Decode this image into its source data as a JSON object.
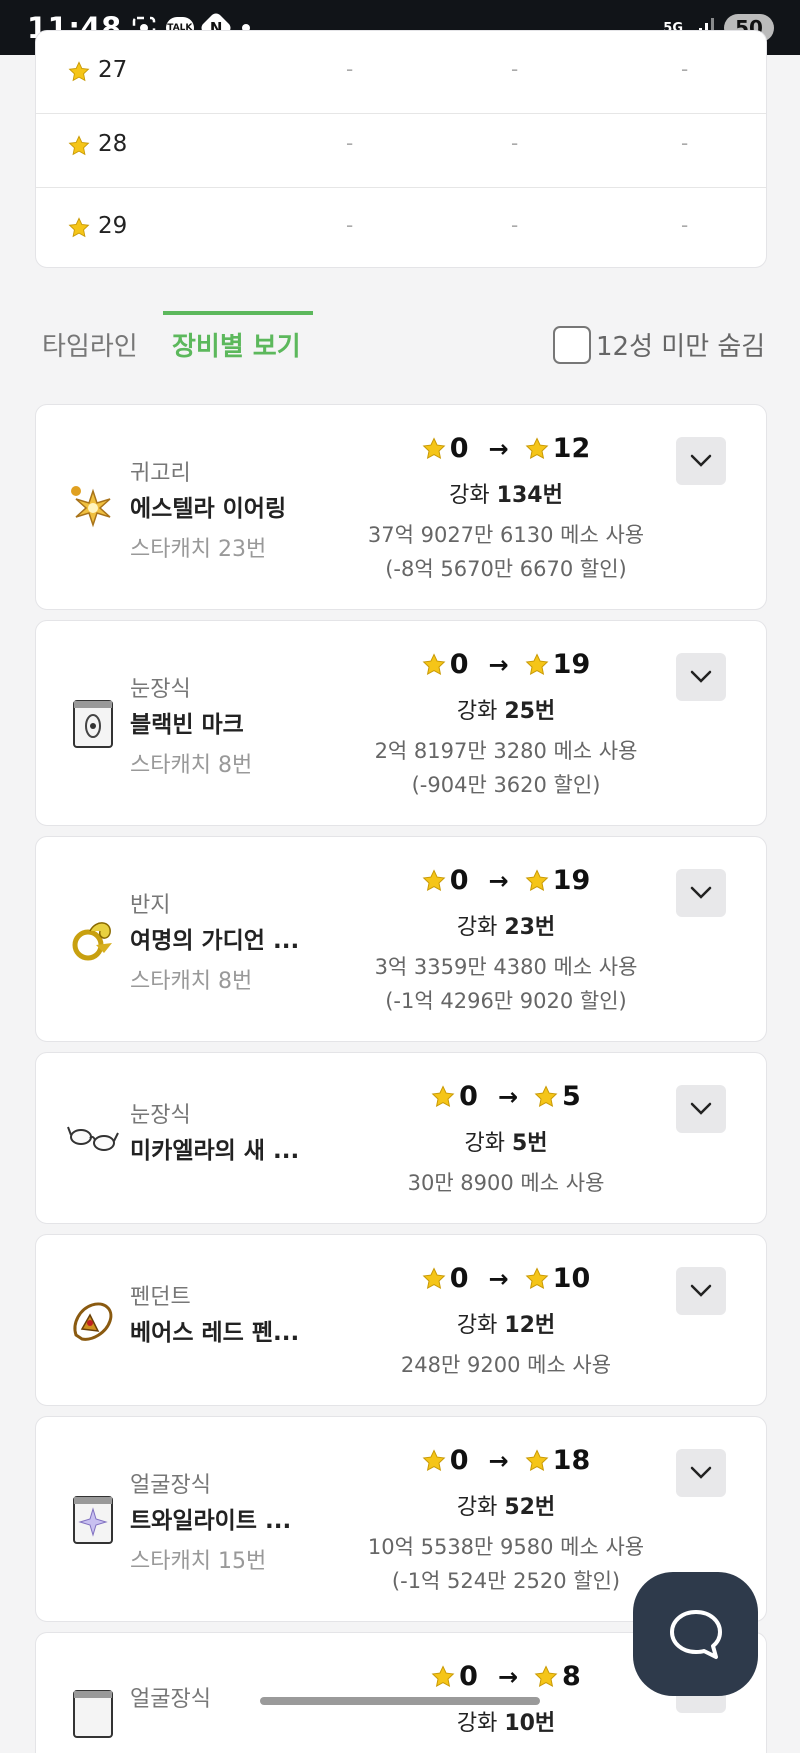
{
  "status_bar": {
    "time": "11:48",
    "talk": "TALK",
    "n": "N",
    "network": "5G",
    "battery": "50"
  },
  "table": {
    "rows": [
      {
        "star": "27",
        "c1": "-",
        "c2": "-",
        "c3": "-"
      },
      {
        "star": "28",
        "c1": "-",
        "c2": "-",
        "c3": "-"
      },
      {
        "star": "29",
        "c1": "-",
        "c2": "-",
        "c3": "-"
      }
    ]
  },
  "tabs": {
    "timeline": "타임라인",
    "by_equipment": "장비별 보기",
    "hide_label": "12성 미만 숨김"
  },
  "items": [
    {
      "type": "귀고리",
      "name": "에스텔라 이어링",
      "starcatch": "스타캐치 23번",
      "from": "0",
      "to": "12",
      "count_prefix": "강화 ",
      "count": "134번",
      "meso": "37억 9027만 6130 메소 사용",
      "discount": "(-8억 5670만 6670 할인)"
    },
    {
      "type": "눈장식",
      "name": "블랙빈 마크",
      "starcatch": "스타캐치 8번",
      "from": "0",
      "to": "19",
      "count_prefix": "강화 ",
      "count": "25번",
      "meso": "2억 8197만 3280 메소 사용",
      "discount": "(-904만 3620 할인)"
    },
    {
      "type": "반지",
      "name": "여명의 가디언 ...",
      "starcatch": "스타캐치 8번",
      "from": "0",
      "to": "19",
      "count_prefix": "강화 ",
      "count": "23번",
      "meso": "3억 3359만 4380 메소 사용",
      "discount": "(-1억 4296만 9020 할인)"
    },
    {
      "type": "눈장식",
      "name": "미카엘라의 새 ...",
      "starcatch": "",
      "from": "0",
      "to": "5",
      "count_prefix": "강화 ",
      "count": "5번",
      "meso": "30만 8900 메소 사용",
      "discount": ""
    },
    {
      "type": "펜던트",
      "name": "베어스 레드 펜...",
      "starcatch": "",
      "from": "0",
      "to": "10",
      "count_prefix": "강화 ",
      "count": "12번",
      "meso": "248만 9200 메소 사용",
      "discount": ""
    },
    {
      "type": "얼굴장식",
      "name": "트와일라이트 ...",
      "starcatch": "스타캐치 15번",
      "from": "0",
      "to": "18",
      "count_prefix": "강화 ",
      "count": "52번",
      "meso": "10억 5538만 9580 메소 사용",
      "discount": "(-1억 524만 2520 할인)"
    },
    {
      "type": "얼굴장식",
      "name": "",
      "starcatch": "",
      "from": "0",
      "to": "8",
      "count_prefix": "강화 ",
      "count": "10번",
      "meso": "",
      "discount": ""
    }
  ],
  "colors": {
    "accent_green": "#5cb85c",
    "star_gold": "#f5c518",
    "chat_button": "#2e3a4b"
  }
}
